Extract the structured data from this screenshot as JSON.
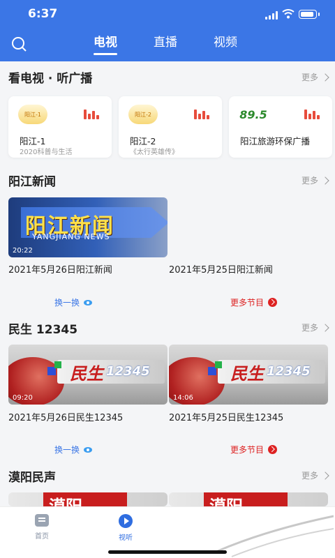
{
  "status": {
    "time": "6:37"
  },
  "tabs": [
    {
      "label": "电视",
      "active": true
    },
    {
      "label": "直播",
      "active": false
    },
    {
      "label": "视频",
      "active": false
    }
  ],
  "radio_section": {
    "title": "看电视 · 听广播",
    "more": "更多",
    "cards": [
      {
        "logo": "阳江-1",
        "name": "阳江-1",
        "sub": "2020科普与生活"
      },
      {
        "logo": "阳江-2",
        "name": "阳江-2",
        "sub": "《太行英雄传》"
      },
      {
        "logo": "89.5",
        "name": "阳江旅游环保广播",
        "sub": ""
      }
    ]
  },
  "news_section": {
    "title": "阳江新闻",
    "more": "更多",
    "thumb_title": "阳江新闻",
    "thumb_en": "YANGJIANG NEWS",
    "items": [
      {
        "duration": "20:22",
        "caption": "2021年5月26日阳江新闻"
      },
      {
        "duration": "",
        "caption": "2021年5月25日阳江新闻"
      }
    ],
    "refresh": "换一换",
    "more_programs": "更多节目"
  },
  "minsheng_section": {
    "title": "民生 12345",
    "more": "更多",
    "thumb_cn": "民生",
    "thumb_num": "12345",
    "items": [
      {
        "duration": "09:20",
        "caption": "2021年5月26日民生12345"
      },
      {
        "duration": "14:06",
        "caption": "2021年5月25日民生12345"
      }
    ],
    "refresh": "换一换",
    "more_programs": "更多节目"
  },
  "moyang_section": {
    "title": "漠阳民声",
    "more": "更多",
    "thumb_text": "漠阳"
  },
  "bottom_nav": [
    {
      "label": "首页",
      "active": false
    },
    {
      "label": "视听",
      "active": true
    }
  ],
  "colors": {
    "brand": "#3b76e6",
    "accent_red": "#d22"
  }
}
